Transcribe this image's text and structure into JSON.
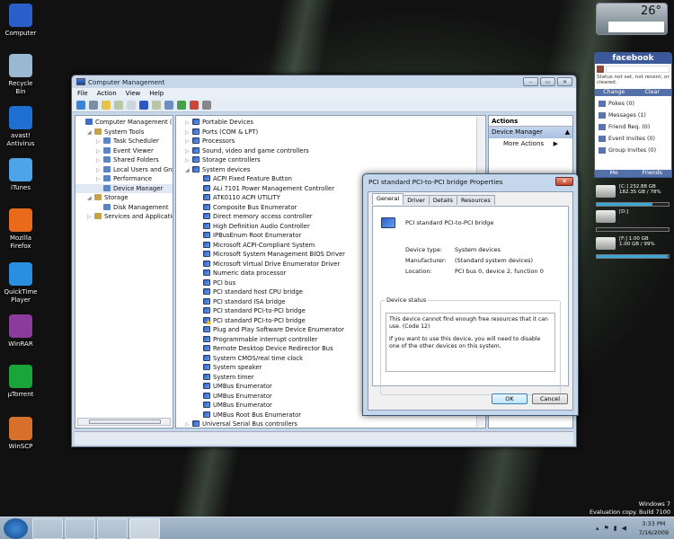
{
  "desktop_icons": [
    {
      "label": "Computer",
      "icon": "computer-icon",
      "color": "#2a5fc9"
    },
    {
      "label": "Recycle Bin",
      "icon": "recycle-bin-icon",
      "color": "#9bb8d3"
    },
    {
      "label": "avast! Antivirus",
      "icon": "avast-icon",
      "color": "#1f6fd1"
    },
    {
      "label": "iTunes",
      "icon": "itunes-icon",
      "color": "#4da4e8"
    },
    {
      "label": "Mozilla Firefox",
      "icon": "firefox-icon",
      "color": "#e86a1a"
    },
    {
      "label": "QuickTime Player",
      "icon": "quicktime-icon",
      "color": "#2a8fe0"
    },
    {
      "label": "WinRAR",
      "icon": "winrar-icon",
      "color": "#8a3b9b"
    },
    {
      "label": "µTorrent",
      "icon": "utorrent-icon",
      "color": "#1aa53a"
    },
    {
      "label": "WinSCP",
      "icon": "winscp-icon",
      "color": "#d6702a"
    }
  ],
  "window": {
    "title": "Computer Management",
    "menu": [
      "File",
      "Action",
      "View",
      "Help"
    ],
    "controls": {
      "minimize": "–",
      "maximize": "▭",
      "close": "✕"
    }
  },
  "left_tree": [
    {
      "label": "Computer Management (Local",
      "level": 0,
      "exp": ""
    },
    {
      "label": "System Tools",
      "level": 1,
      "exp": "◢"
    },
    {
      "label": "Task Scheduler",
      "level": 2,
      "exp": "▷"
    },
    {
      "label": "Event Viewer",
      "level": 2,
      "exp": "▷"
    },
    {
      "label": "Shared Folders",
      "level": 2,
      "exp": "▷"
    },
    {
      "label": "Local Users and Groups",
      "level": 2,
      "exp": "▷"
    },
    {
      "label": "Performance",
      "level": 2,
      "exp": "▷"
    },
    {
      "label": "Device Manager",
      "level": 2,
      "exp": "",
      "selected": true
    },
    {
      "label": "Storage",
      "level": 1,
      "exp": "◢"
    },
    {
      "label": "Disk Management",
      "level": 2,
      "exp": ""
    },
    {
      "label": "Services and Applications",
      "level": 1,
      "exp": "▷"
    }
  ],
  "device_tree": [
    {
      "label": "Portable Devices",
      "level": 0,
      "exp": "▷"
    },
    {
      "label": "Ports (COM & LPT)",
      "level": 0,
      "exp": "▷"
    },
    {
      "label": "Processors",
      "level": 0,
      "exp": "▷"
    },
    {
      "label": "Sound, video and game controllers",
      "level": 0,
      "exp": "▷"
    },
    {
      "label": "Storage controllers",
      "level": 0,
      "exp": "▷"
    },
    {
      "label": "System devices",
      "level": 0,
      "exp": "◢"
    },
    {
      "label": "ACPI Fixed Feature Button",
      "level": 1
    },
    {
      "label": "ALi 7101 Power Management Controller",
      "level": 1
    },
    {
      "label": "ATK0110 ACPI UTILITY",
      "level": 1
    },
    {
      "label": "Composite Bus Enumerator",
      "level": 1
    },
    {
      "label": "Direct memory access controller",
      "level": 1
    },
    {
      "label": "High Definition Audio Controller",
      "level": 1
    },
    {
      "label": "IPBusEnum Root Enumerator",
      "level": 1
    },
    {
      "label": "Microsoft ACPI-Compliant System",
      "level": 1
    },
    {
      "label": "Microsoft System Management BIOS Driver",
      "level": 1
    },
    {
      "label": "Microsoft Virtual Drive Enumerator Driver",
      "level": 1
    },
    {
      "label": "Numeric data processor",
      "level": 1
    },
    {
      "label": "PCI bus",
      "level": 1
    },
    {
      "label": "PCI standard host CPU bridge",
      "level": 1
    },
    {
      "label": "PCI standard ISA bridge",
      "level": 1
    },
    {
      "label": "PCI standard PCI-to-PCI bridge",
      "level": 1
    },
    {
      "label": "PCI standard PCI-to-PCI bridge",
      "level": 1,
      "warning": true
    },
    {
      "label": "Plug and Play Software Device Enumerator",
      "level": 1
    },
    {
      "label": "Programmable interrupt controller",
      "level": 1
    },
    {
      "label": "Remote Desktop Device Redirector Bus",
      "level": 1
    },
    {
      "label": "System CMOS/real time clock",
      "level": 1
    },
    {
      "label": "System speaker",
      "level": 1
    },
    {
      "label": "System timer",
      "level": 1
    },
    {
      "label": "UMBus Enumerator",
      "level": 1
    },
    {
      "label": "UMBus Enumerator",
      "level": 1
    },
    {
      "label": "UMBus Enumerator",
      "level": 1
    },
    {
      "label": "UMBus Root Bus Enumerator",
      "level": 1
    },
    {
      "label": "Universal Serial Bus controllers",
      "level": 0,
      "exp": "▷"
    }
  ],
  "actions": {
    "header": "Actions",
    "section": "Device Manager",
    "more": "More Actions"
  },
  "dialog": {
    "title": "PCI standard PCI-to-PCI bridge Properties",
    "close": "✕",
    "tabs": [
      "General",
      "Driver",
      "Details",
      "Resources"
    ],
    "device_name": "PCI standard PCI-to-PCI bridge",
    "fields": [
      {
        "key": "Device type:",
        "value": "System devices"
      },
      {
        "key": "Manufacturer:",
        "value": "(Standard system devices)"
      },
      {
        "key": "Location:",
        "value": "PCI bus 0, device 2, function 0"
      }
    ],
    "status_legend": "Device status",
    "status_line1": "This device cannot find enough free resources that it can use. (Code 12)",
    "status_line2": "If you want to use this device, you will need to disable one of the other devices on this system.",
    "ok": "OK",
    "cancel": "Cancel"
  },
  "weather": {
    "temp": "26°"
  },
  "facebook": {
    "title": "facebook",
    "status": "Status not set, not recent, or cleared.",
    "change": "Change",
    "clear": "Clear",
    "items": [
      "Pokes (0)",
      "Messages (1)",
      "Friend Req. (0)",
      "Event Invites (0)",
      "Group Invites (0)"
    ],
    "me": "Me",
    "friends": "Friends"
  },
  "drives": [
    {
      "line1": "[C:] 232.88 GB",
      "line2": "182.35 GB / 78%",
      "used_pct": 78
    },
    {
      "line1": "[D:]",
      "line2": "",
      "used_pct": 0
    },
    {
      "line1": "[F:] 1.00 GB",
      "line2": "1.00 GB / 99%",
      "used_pct": 99
    }
  ],
  "watermark": {
    "line1": "Windows 7",
    "line2": "Evaluation copy. Build 7100"
  },
  "taskbar": {
    "time": "3:33 PM",
    "date": "7/16/2009",
    "apps": [
      "internet-explorer-icon",
      "messenger-icon",
      "explorer-icon",
      "computer-management-icon"
    ]
  }
}
